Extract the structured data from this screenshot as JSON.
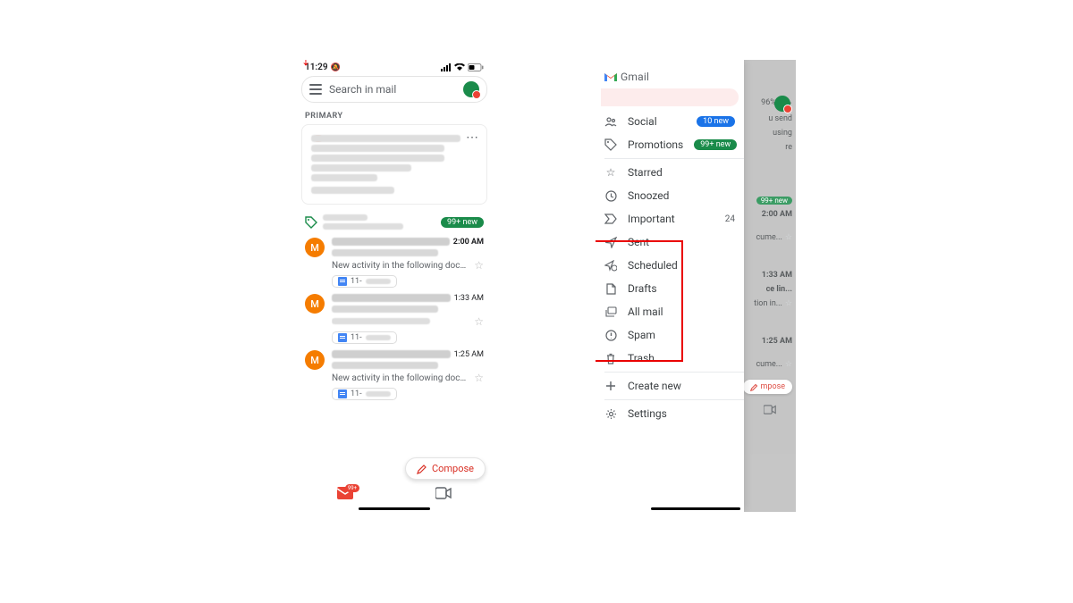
{
  "status": {
    "time": "11:29",
    "silent_icon": "🔕"
  },
  "search": {
    "placeholder": "Search in mail"
  },
  "primary_label": "PRIMARY",
  "promotions_pill": "99+ new",
  "threads": [
    {
      "initial": "M",
      "time": "2:00 AM",
      "snippet": "New activity in the following docume...",
      "chip": "11-"
    },
    {
      "initial": "M",
      "time": "1:33 AM",
      "snippet": "",
      "chip": "11-"
    },
    {
      "initial": "M",
      "time": "1:25 AM",
      "snippet": "New activity in the following docume...",
      "chip": "11-"
    }
  ],
  "compose": "Compose",
  "mail_badge": "99+",
  "drawer": {
    "brand": "Gmail",
    "items": [
      {
        "label": "Social",
        "badge": "10 new",
        "badge_color": "blue"
      },
      {
        "label": "Promotions",
        "badge": "99+ new",
        "badge_color": "green"
      },
      {
        "label": "Starred"
      },
      {
        "label": "Snoozed"
      },
      {
        "label": "Important",
        "count": "24"
      },
      {
        "label": "Sent"
      },
      {
        "label": "Scheduled"
      },
      {
        "label": "Drafts"
      },
      {
        "label": "All mail"
      },
      {
        "label": "Spam"
      },
      {
        "label": "Trash"
      },
      {
        "label": "Create new"
      },
      {
        "label": "Settings"
      }
    ]
  },
  "backdrop": {
    "pct": "96%)",
    "t1": "u send",
    "t2": "using",
    "t3": "re",
    "pill": "99+ new",
    "time1": "2:00 AM",
    "snip1": "cume...",
    "time2": "1:33 AM",
    "snip2a": "ce lin...",
    "snip2b": "tion in...",
    "time3": "1:25 AM",
    "snip3": "cume...",
    "compose": "mpose"
  }
}
